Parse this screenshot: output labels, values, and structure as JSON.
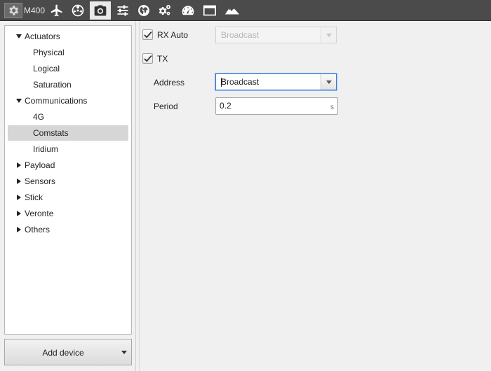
{
  "colors": {
    "toolbar_bg": "#4b4b4b",
    "active_tab_bg": "#e9e9e9",
    "selection_bg": "#d6d6d6",
    "focus_border": "#3a7bd5"
  },
  "toolbar": {
    "device_label": "M400",
    "icons": [
      "gear-icon",
      "airplane-icon",
      "radiation-icon",
      "camera-icon",
      "sliders-icon",
      "globe-icon",
      "gears-icon",
      "gauge-icon",
      "window-icon",
      "mountains-icon"
    ],
    "active_icon": "camera-icon"
  },
  "tree": {
    "actuators": "Actuators",
    "physical": "Physical",
    "logical": "Logical",
    "saturation": "Saturation",
    "communications": "Communications",
    "fourg": "4G",
    "comstats": "Comstats",
    "iridium": "Iridium",
    "payload": "Payload",
    "sensors": "Sensors",
    "stick": "Stick",
    "veronte": "Veronte",
    "others": "Others",
    "selected": "Comstats"
  },
  "add_device": {
    "label": "Add device"
  },
  "form": {
    "rx_auto": {
      "label": "RX Auto",
      "checked": true,
      "value": "Broadcast"
    },
    "tx": {
      "label": "TX",
      "checked": true
    },
    "address": {
      "label": "Address",
      "value": "Broadcast"
    },
    "period": {
      "label": "Period",
      "value": "0.2",
      "unit": "s"
    }
  }
}
